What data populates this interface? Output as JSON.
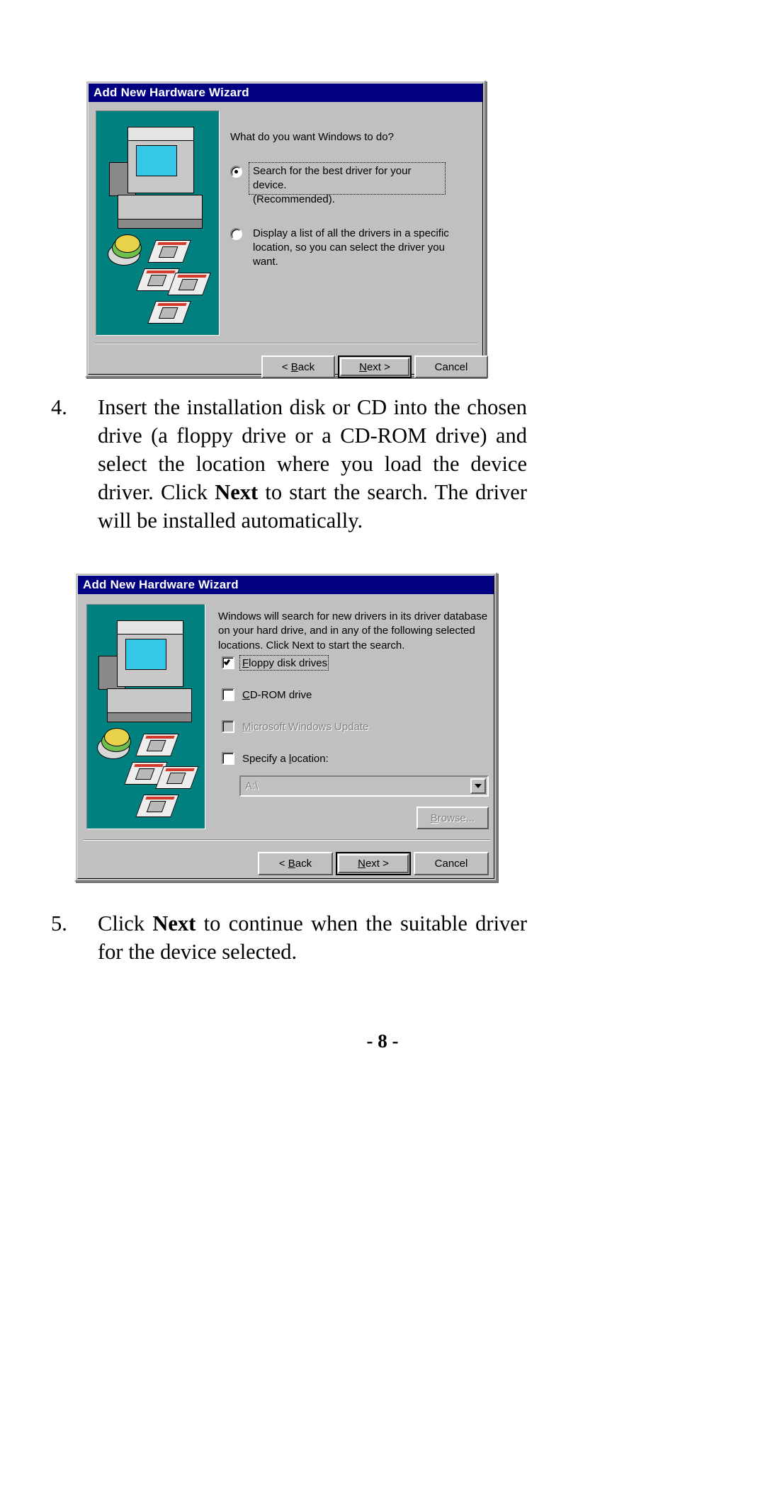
{
  "document": {
    "page_number": "- 8 -"
  },
  "dialog1": {
    "title": "Add New Hardware Wizard",
    "prompt": "What do you want Windows to do?",
    "options": [
      {
        "label_line1": "Search for the best driver for your device.",
        "label_line2": "(Recommended).",
        "selected": true,
        "focused": true
      },
      {
        "label_line1": "Display a list of all the drivers in a specific",
        "label_line2": "location, so you can select the driver you want.",
        "selected": false,
        "focused": false
      }
    ],
    "buttons": {
      "back": "< Back",
      "back_mnemonic": "B",
      "next": "Next >",
      "next_mnemonic": "N",
      "cancel": "Cancel"
    }
  },
  "step4": {
    "number": "4.",
    "text_part1": "Insert the installation disk or CD into the chosen drive (a floppy drive or a CD-ROM drive) and select the location where you load the device driver. Click ",
    "bold_word": "Next",
    "text_part2": " to start the search. The driver will be installed automatically."
  },
  "dialog2": {
    "title": "Add New Hardware Wizard",
    "body_line1": "Windows will search for new drivers in its driver database",
    "body_line2": "on your hard drive, and in any of the following selected",
    "body_line3": "locations. Click Next to start the search.",
    "checkboxes": [
      {
        "label": "Floppy disk drives",
        "mnemonic": "F",
        "checked": true,
        "disabled": false,
        "focused": true
      },
      {
        "label": "CD-ROM drive",
        "mnemonic": "C",
        "checked": false,
        "disabled": false,
        "focused": false
      },
      {
        "label": "Microsoft Windows Update",
        "mnemonic": "M",
        "checked": false,
        "disabled": true,
        "focused": false
      },
      {
        "label": "Specify a location:",
        "mnemonic": "l",
        "checked": false,
        "disabled": false,
        "focused": false
      }
    ],
    "location_combo": {
      "value": "A:\\",
      "disabled": true
    },
    "browse_button": {
      "label": "Browse...",
      "mnemonic": "B",
      "disabled": true
    },
    "buttons": {
      "back": "< Back",
      "back_mnemonic": "B",
      "next": "Next >",
      "next_mnemonic": "N",
      "cancel": "Cancel"
    }
  },
  "step5": {
    "number": "5.",
    "text_part1": "Click ",
    "bold_word": "Next",
    "text_part2": " to continue when the suitable driver for the device selected."
  },
  "colors": {
    "titlebar": "#000080",
    "dialog_face": "#c0c0c0",
    "illustration": "#00807f",
    "disabled_text": "#818181"
  }
}
